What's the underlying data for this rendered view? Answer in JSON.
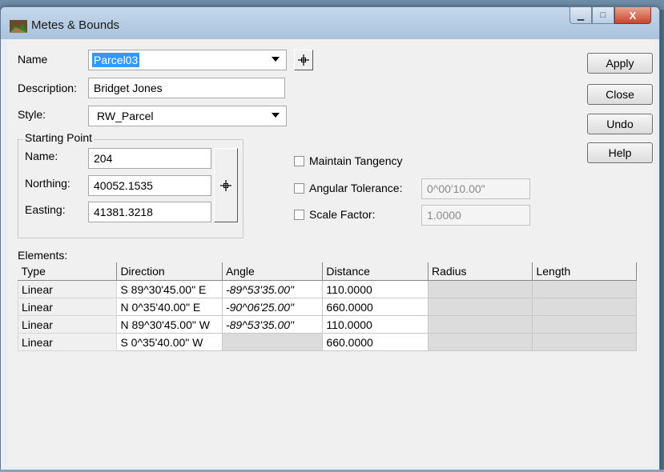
{
  "window": {
    "title": "Metes & Bounds",
    "minimize_glyph": "▁",
    "maximize_glyph": "□",
    "close_glyph": "X"
  },
  "form": {
    "name_label": "Name",
    "name_value": "Parcel03",
    "description_label": "Description:",
    "description_value": "Bridget Jones",
    "style_label": "Style:",
    "style_value": "RW_Parcel"
  },
  "buttons": {
    "apply": "Apply",
    "close": "Close",
    "undo": "Undo",
    "help": "Help"
  },
  "starting_point": {
    "title": "Starting Point",
    "name_label": "Name:",
    "name_value": "204",
    "northing_label": "Northing:",
    "northing_value": "40052.1535",
    "easting_label": "Easting:",
    "easting_value": "41381.3218"
  },
  "options": {
    "maintain_tangency": "Maintain Tangency",
    "angular_tolerance_label": "Angular Tolerance:",
    "angular_tolerance_value": "0^00'10.00\"",
    "scale_factor_label": "Scale Factor:",
    "scale_factor_value": "1.0000"
  },
  "elements": {
    "label": "Elements:",
    "columns": [
      "Type",
      "Direction",
      "Angle",
      "Distance",
      "Radius",
      "Length"
    ],
    "rows": [
      {
        "type": "Linear",
        "direction": "S 89^30'45.00\" E",
        "angle": "-89^53'35.00\"",
        "distance": "110.0000"
      },
      {
        "type": "Linear",
        "direction": "N  0^35'40.00\" E",
        "angle": "-90^06'25.00\"",
        "distance": "660.0000"
      },
      {
        "type": "Linear",
        "direction": "N 89^30'45.00\" W",
        "angle": "-89^53'35.00\"",
        "distance": "110.0000"
      },
      {
        "type": "Linear",
        "direction": "S  0^35'40.00\" W",
        "angle": "",
        "distance": "660.0000"
      }
    ]
  },
  "colors": {
    "selection": "#3399ff",
    "titlebar": "#a9c3dc",
    "close_button": "#c9452b"
  }
}
